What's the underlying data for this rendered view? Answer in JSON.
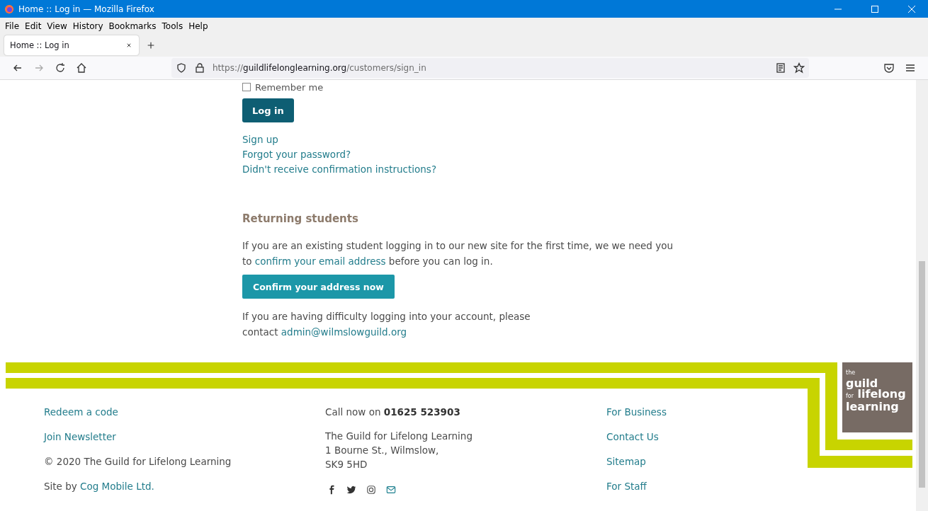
{
  "window": {
    "title": "Home :: Log in — Mozilla Firefox"
  },
  "menu": [
    "File",
    "Edit",
    "View",
    "History",
    "Bookmarks",
    "Tools",
    "Help"
  ],
  "tabs": [
    {
      "label": "Home :: Log in",
      "selected": true
    }
  ],
  "address": {
    "scheme": "https://",
    "domain": "guildlifelonglearning.org",
    "path": "/customers/sign_in"
  },
  "form": {
    "remember_me": {
      "label": "Remember me",
      "checked": false
    },
    "login_button": "Log in",
    "links": [
      "Sign up",
      "Forgot your password?",
      "Didn't receive confirmation instructions?"
    ]
  },
  "returning": {
    "heading": "Returning students",
    "intro": {
      "before": "If you are an existing student logging in to our new site for the first time, we we need you to ",
      "link": "confirm your email address",
      "after": " before you can log in."
    },
    "button": "Confirm your address now",
    "help": {
      "before": "If you are having difficulty logging into your account, please contact ",
      "link": "admin@wilmslowguild.org"
    }
  },
  "footer": {
    "column_1": [
      {
        "kind": "link",
        "text": "Redeem a code"
      },
      {
        "kind": "link",
        "text": "Join Newsletter"
      },
      {
        "kind": "text",
        "text": "© 2020 The Guild for Lifelong Learning"
      },
      {
        "kind": "credit",
        "text": "Site by ",
        "link": "Cog Mobile Ltd."
      }
    ],
    "call": {
      "text": "Call now on ",
      "number": "01625 523903"
    },
    "address_lines": [
      "The Guild for Lifelong Learning",
      "1 Bourne St., Wilmslow,",
      "SK9 5HD"
    ],
    "column_3": [
      "For Business",
      "Contact Us",
      "Sitemap",
      "For Staff"
    ]
  },
  "logo": {
    "small_1": "the",
    "big_1": "guild",
    "small_2": "for",
    "big_2": "lifelong",
    "big_3": "learning"
  }
}
